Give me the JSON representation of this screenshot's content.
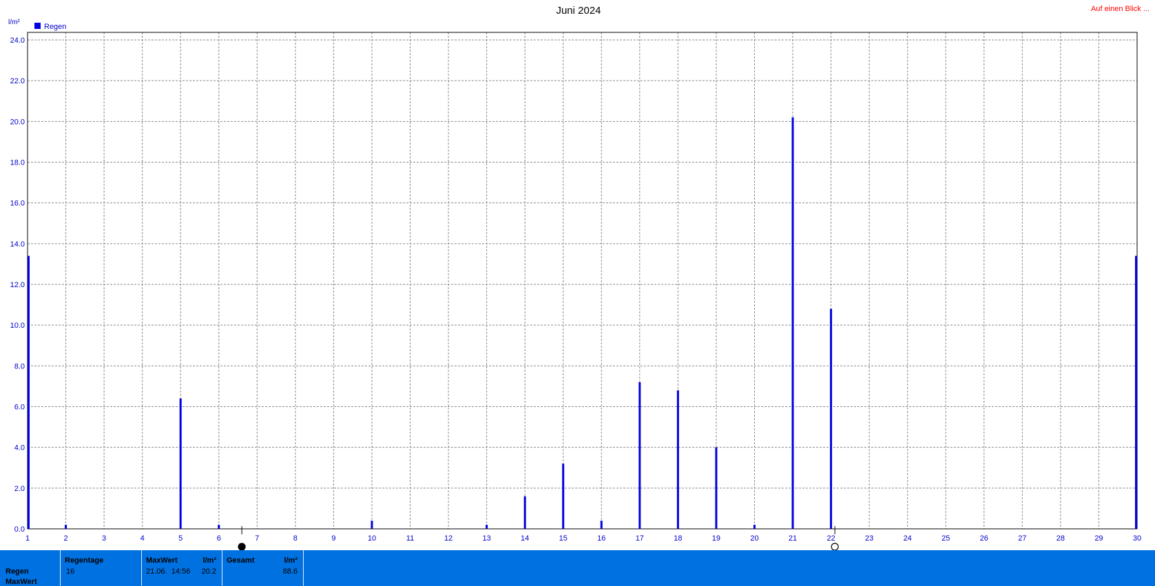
{
  "link_text": "Auf einen Blick ...",
  "chart_data": {
    "type": "bar",
    "title": "Juni 2024",
    "ylabel": "l/m²",
    "legend": [
      {
        "name": "Regen",
        "color": "#0000e0"
      }
    ],
    "ylim": [
      0,
      24
    ],
    "xlim": [
      1,
      30
    ],
    "grid": true,
    "yticks": [
      "0.0",
      "2.0",
      "4.0",
      "6.0",
      "8.0",
      "10.0",
      "12.0",
      "14.0",
      "16.0",
      "18.0",
      "20.0",
      "22.0",
      "24.0"
    ],
    "xticks": [
      "1",
      "2",
      "3",
      "4",
      "5",
      "6",
      "7",
      "8",
      "9",
      "10",
      "11",
      "12",
      "13",
      "14",
      "15",
      "16",
      "17",
      "18",
      "19",
      "20",
      "21",
      "22",
      "23",
      "24",
      "25",
      "26",
      "27",
      "28",
      "29",
      "30"
    ],
    "series": [
      {
        "name": "Regen",
        "color": "#0000e0",
        "points": [
          {
            "x": 1,
            "y": 13.4
          },
          {
            "x": 2,
            "y": 0.2
          },
          {
            "x": 5,
            "y": 6.4
          },
          {
            "x": 6,
            "y": 0.2
          },
          {
            "x": 10,
            "y": 0.4
          },
          {
            "x": 13,
            "y": 0.2
          },
          {
            "x": 14,
            "y": 1.6
          },
          {
            "x": 15,
            "y": 3.2
          },
          {
            "x": 16,
            "y": 0.4
          },
          {
            "x": 17,
            "y": 7.2
          },
          {
            "x": 18,
            "y": 6.8
          },
          {
            "x": 19,
            "y": 4.0
          },
          {
            "x": 20,
            "y": 0.2
          },
          {
            "x": 21,
            "y": 20.2
          },
          {
            "x": 22,
            "y": 10.8
          },
          {
            "x": 30,
            "y": 13.4
          }
        ]
      }
    ],
    "moon_phases": [
      {
        "x": 6.6,
        "phase": "new"
      },
      {
        "x": 22.1,
        "phase": "full"
      }
    ]
  },
  "stats": {
    "row_labels": [
      "Regen",
      "MaxWert"
    ],
    "regentage": {
      "label": "Regentage",
      "value": "16"
    },
    "maxwert": {
      "label": "MaxWert",
      "unit": "l/m²",
      "date": "21.06.  14:56",
      "value": "20.2"
    },
    "gesamt": {
      "label": "Gesamt",
      "unit": "l/m²",
      "value": "88.6"
    }
  }
}
